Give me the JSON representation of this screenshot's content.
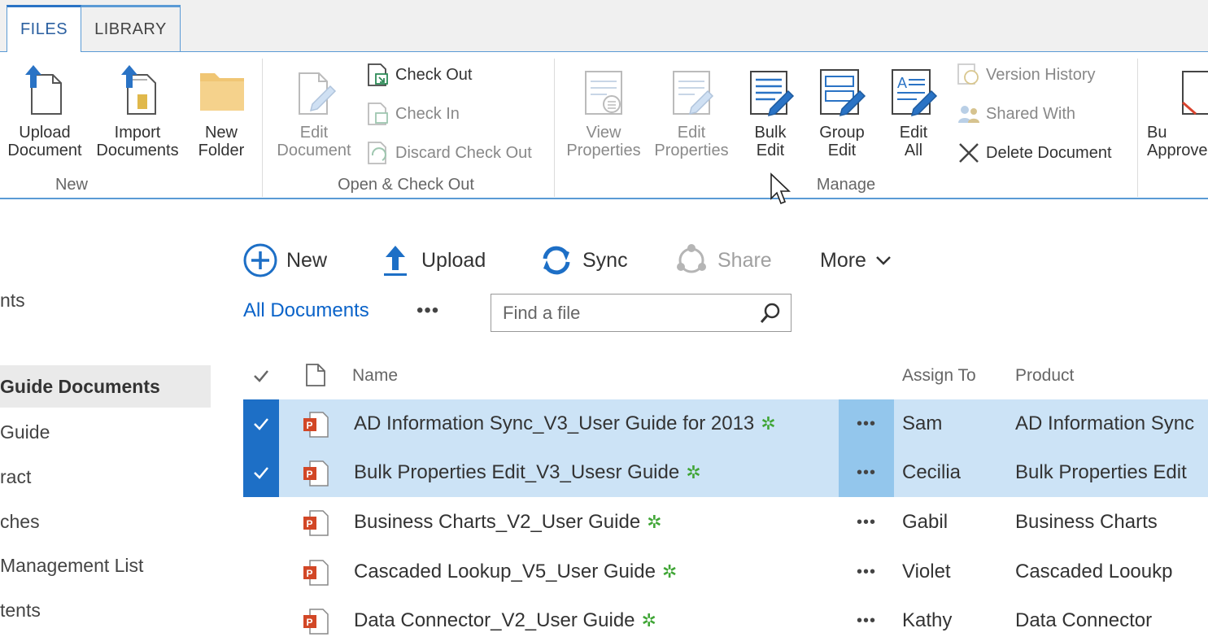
{
  "ribbon": {
    "tabs": [
      {
        "label": "FILES"
      },
      {
        "label": "LIBRARY"
      }
    ],
    "groups": {
      "new": {
        "label": "New",
        "upload_document": "Upload\nDocument",
        "import_documents": "Import\nDocuments",
        "new_folder": "New\nFolder"
      },
      "open_checkout": {
        "label": "Open & Check Out",
        "edit_document": "Edit\nDocument",
        "check_out": "Check Out",
        "check_in": "Check In",
        "discard_check_out": "Discard Check Out"
      },
      "manage": {
        "label": "Manage",
        "view_properties": "View\nProperties",
        "edit_properties": "Edit\nProperties",
        "bulk_edit": "Bulk\nEdit",
        "group_edit": "Group\nEdit",
        "edit_all": "Edit\nAll",
        "version_history": "Version History",
        "shared_with": "Shared With",
        "delete_document": "Delete Document"
      },
      "approve": {
        "bulk_approve": "Bu\nApprove"
      }
    }
  },
  "leftnav": {
    "items": [
      {
        "label": "nts"
      },
      {
        "label": "Guide Documents"
      },
      {
        "label": "Guide"
      },
      {
        "label": "ract"
      },
      {
        "label": "ches"
      },
      {
        "label": "Management List"
      },
      {
        "label": "tents"
      }
    ]
  },
  "commandbar": {
    "new": "New",
    "upload": "Upload",
    "sync": "Sync",
    "share": "Share",
    "more": "More"
  },
  "view": {
    "all_documents": "All Documents",
    "dots": "•••",
    "search_placeholder": "Find a file"
  },
  "table": {
    "columns": {
      "name": "Name",
      "assign_to": "Assign To",
      "product": "Product"
    },
    "rows": [
      {
        "name": "AD Information Sync_V3_User Guide for 2013",
        "assign": "Sam",
        "product": "AD Information Sync",
        "selected": true
      },
      {
        "name": "Bulk Properties Edit_V3_Usesr Guide",
        "assign": "Cecilia",
        "product": "Bulk Properties Edit",
        "selected": true
      },
      {
        "name": "Business Charts_V2_User Guide",
        "assign": "Gabil",
        "product": "Business Charts",
        "selected": false
      },
      {
        "name": "Cascaded Lookup_V5_User Guide",
        "assign": "Violet",
        "product": "Cascaded Looukp",
        "selected": false
      },
      {
        "name": "Data Connector_V2_User Guide",
        "assign": "Kathy",
        "product": "Data Connector",
        "selected": false
      }
    ],
    "row_dots": "•••",
    "new_mark": "✲"
  },
  "colors": {
    "accent": "#1d6fc6",
    "selected_row": "#cce3f6",
    "link": "#0a63c9"
  }
}
